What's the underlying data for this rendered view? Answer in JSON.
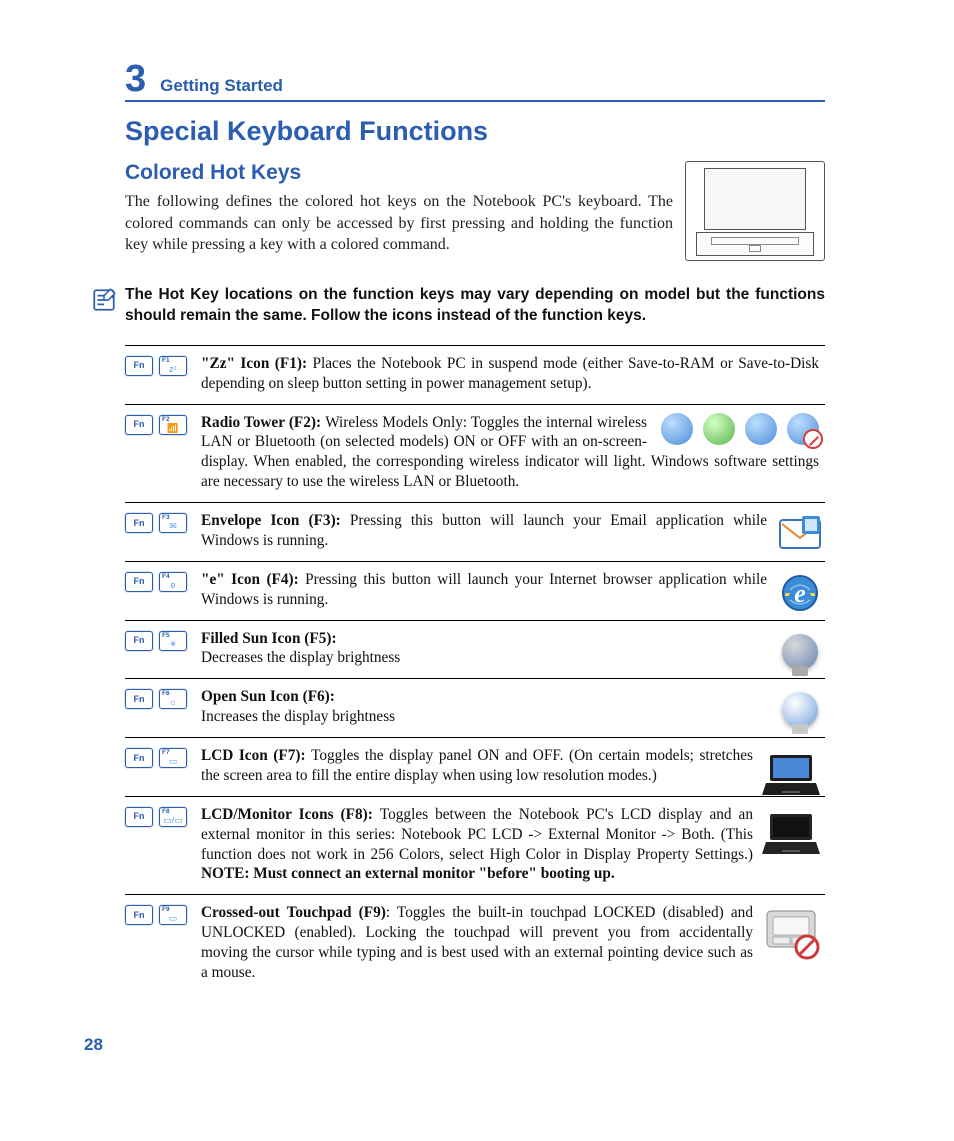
{
  "chapter": {
    "number": "3",
    "title": "Getting Started"
  },
  "h1": "Special Keyboard Functions",
  "h2": "Colored Hot Keys",
  "intro": "The following defines the colored hot keys on the Notebook PC's keyboard. The colored commands can only be accessed by first pressing and holding the function key while pressing a key with a colored command.",
  "note": "The Hot Key locations on the function keys may vary depending on model but the functions should remain the same. Follow the icons instead of the function keys.",
  "fn_label": "Fn",
  "entries": [
    {
      "fkey": "F1",
      "glyph": "zᶻ",
      "title": "\"Zz\" Icon (F1): ",
      "text": "Places the Notebook PC in suspend mode (either Save-to-RAM or Save-to-Disk depending on sleep button setting in power management setup).",
      "style": "plain"
    },
    {
      "fkey": "F2",
      "glyph": "📶",
      "title": "Radio Tower (F2): ",
      "text1": "Wireless Models Only: Toggles the internal wireless LAN or Bluetooth (on selected models) ON or OFF with an on-screen-display. When enabled, the ",
      "text2": "corresponding wireless indicator will light. Windows software settings are necessary to use the wireless LAN or Bluetooth.",
      "style": "radio"
    },
    {
      "fkey": "F3",
      "glyph": "✉",
      "title": "Envelope Icon (F3): ",
      "text": "Pressing this button will launch your Email application while Windows is running.",
      "style": "mail"
    },
    {
      "fkey": "F4",
      "glyph": "e",
      "title": "\"e\" Icon (F4): ",
      "text": "Pressing this button will launch your Internet browser application while Windows is running.",
      "style": "ie"
    },
    {
      "fkey": "F5",
      "glyph": "☀",
      "title": "Filled Sun Icon (F5):",
      "text": "Decreases the display brightness",
      "style": "bulb-dim",
      "break": true
    },
    {
      "fkey": "F6",
      "glyph": "☼",
      "title": "Open Sun Icon (F6):",
      "text": "Increases the display brightness",
      "style": "bulb",
      "break": true
    },
    {
      "fkey": "F7",
      "glyph": "▭",
      "title": "LCD Icon (F7): ",
      "text": "Toggles the display panel ON and OFF. (On certain models; stretches the screen area to fill the entire display when using low resolution modes.)",
      "style": "laptop1"
    },
    {
      "fkey": "F8",
      "glyph": "▭/▭",
      "title": "LCD/Monitor Icons (F8): ",
      "text": "Toggles between the Notebook PC's LCD display and an external monitor in this series: Notebook PC LCD -> External Monitor -> Both. (This function does not work in 256 Colors, select High Color in Display Property Settings.) ",
      "postbold": "NOTE: Must connect an external monitor \"before\" booting up.",
      "style": "laptop2"
    },
    {
      "fkey": "F9",
      "glyph": "▭",
      "title": "Crossed-out Touchpad (F9)",
      "text": ": Toggles the built-in touchpad LOCKED (disabled) and UNLOCKED (enabled). Locking the touchpad will prevent you from accidentally moving the cursor while typing and is best used with an external pointing device such as a mouse.",
      "style": "touchpad"
    }
  ],
  "page_number": "28"
}
